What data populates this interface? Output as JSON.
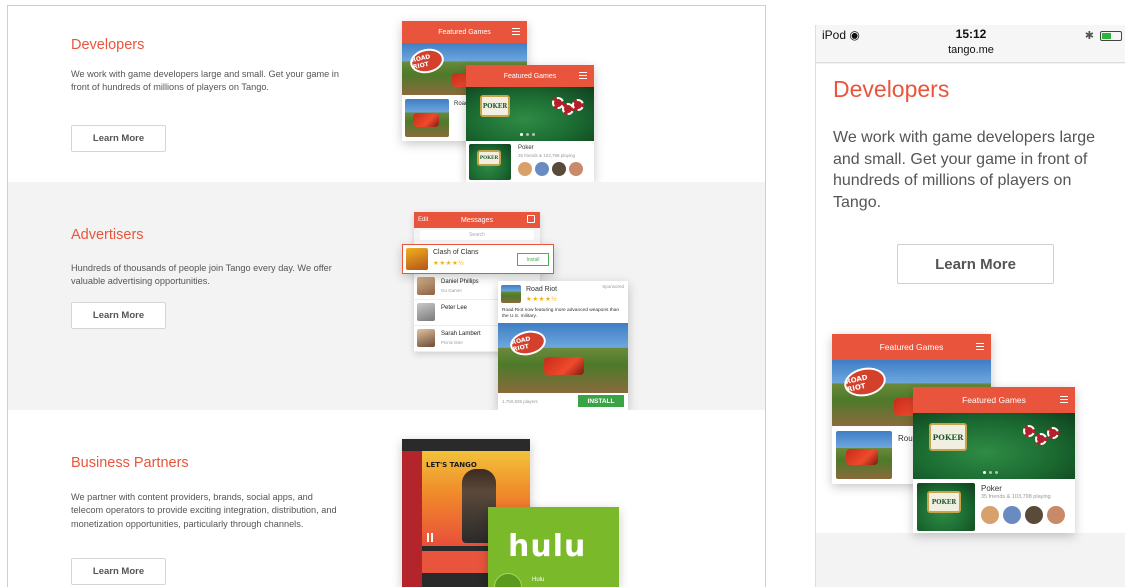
{
  "desktop": {
    "sections": [
      {
        "title": "Developers",
        "body": "We work with game developers large and small. Get your game in front of hundreds of millions of players on Tango.",
        "button": "Learn More"
      },
      {
        "title": "Advertisers",
        "body": "Hundreds of thousands of people join Tango every day. We offer valuable advertising opportunities.",
        "button": "Learn More"
      },
      {
        "title": "Business Partners",
        "body": "We partner with content providers, brands, social apps, and telecom operators to provide exciting integration, distribution, and monetization opportunities, particularly through channels.",
        "button": "Learn More"
      }
    ],
    "featured": {
      "header": "Featured Games",
      "back_row_title": "Road",
      "poker_title": "Poker",
      "poker_sub": "35 friends & 103,798 playing",
      "road_logo": "ROAD RIOT",
      "poker_logo": "POKER"
    },
    "messages": {
      "edit": "Edit",
      "title": "Messages",
      "search_placeholder": "Search",
      "ad_app": "Clash of Clans",
      "ad_stars": "★★★★½",
      "ad_install": "Install",
      "contacts": [
        {
          "name": "Daniel Phillips",
          "sub": "Go Game!"
        },
        {
          "name": "Peter Lee",
          "sub": ""
        },
        {
          "name": "Sarah Lambert",
          "sub": "Picnic time"
        }
      ],
      "promo_app": "Road Riot",
      "promo_tag": "Sponsored",
      "promo_stars": "★★★★½",
      "promo_text": "Road Riot now featuring more advanced weapons than the U.S. military.",
      "promo_players": "1,750,835 players",
      "promo_install": "INSTALL",
      "promo_logo": "ROAD RIOT"
    },
    "partners": {
      "video_title": "LET'S TANGO",
      "hulu_logo": "hulu",
      "hulu_caption": "Hulu"
    }
  },
  "mobile": {
    "status": {
      "device": "iPod",
      "time": "15:12",
      "url": "tango.me"
    },
    "title": "Developers",
    "body": "We work with game developers large and small. Get your game in front of hundreds of millions of players on Tango.",
    "button": "Learn More",
    "featured": {
      "header": "Featured Games",
      "back_row_title": "Rou",
      "poker_title": "Poker",
      "poker_sub": "35 friends & 103,798 playing",
      "road_logo": "ROAD RIOT",
      "poker_logo": "POKER"
    }
  },
  "colors": {
    "accent": "#e8553c",
    "install_green": "#3aa346",
    "hulu_green": "#7ab929",
    "section_gray": "#f3f3f3"
  }
}
